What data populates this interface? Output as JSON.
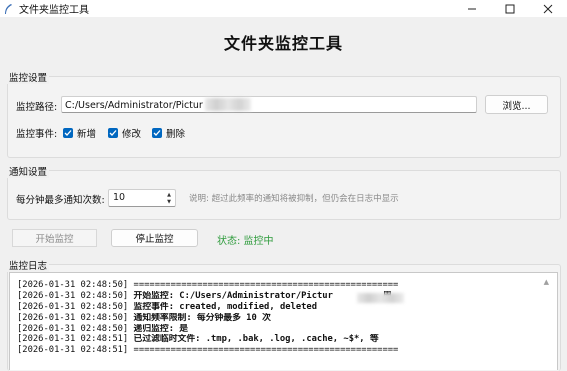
{
  "window": {
    "title": "文件夹监控工具",
    "controls": {
      "minimize": "—",
      "close": "✕"
    }
  },
  "header": {
    "title": "文件夹监控工具"
  },
  "monitor_settings": {
    "group_label": "监控设置",
    "path_label": "监控路径:",
    "path_value": "C:/Users/Administrator/Pictur",
    "browse_label": "浏览...",
    "events_label": "监控事件:",
    "events": [
      {
        "label": "新增",
        "checked": true
      },
      {
        "label": "修改",
        "checked": true
      },
      {
        "label": "删除",
        "checked": true
      }
    ]
  },
  "notify_settings": {
    "group_label": "通知设置",
    "max_label": "每分钟最多通知次数:",
    "max_value": "10",
    "hint": "说明: 超过此频率的通知将被抑制，但仍会在日志中显示"
  },
  "controls": {
    "start_label": "开始监控",
    "stop_label": "停止监控",
    "status_text": "状态: 监控中",
    "status_color": "#2e9b3c"
  },
  "log": {
    "group_label": "监控日志",
    "entries": [
      {
        "time": "[2026-01-31 02:48:50]",
        "msg": "==================================================",
        "bold": false
      },
      {
        "time": "[2026-01-31 02:48:50]",
        "msg": "开始监控: C:/Users/Administrator/Pictur",
        "tail": "周",
        "bold": true
      },
      {
        "time": "[2026-01-31 02:48:50]",
        "msg": "监控事件: created, modified, deleted",
        "bold": true
      },
      {
        "time": "[2026-01-31 02:48:50]",
        "msg": "通知频率限制: 每分钟最多 10 次",
        "bold": true
      },
      {
        "time": "[2026-01-31 02:48:50]",
        "msg": "递归监控: 是",
        "bold": true
      },
      {
        "time": "[2026-01-31 02:48:51]",
        "msg": "已过滤临时文件: .tmp, .bak, .log, .cache, ~$*, 等",
        "bold": true
      },
      {
        "time": "[2026-01-31 02:48:51]",
        "msg": "==================================================",
        "bold": false
      }
    ]
  }
}
